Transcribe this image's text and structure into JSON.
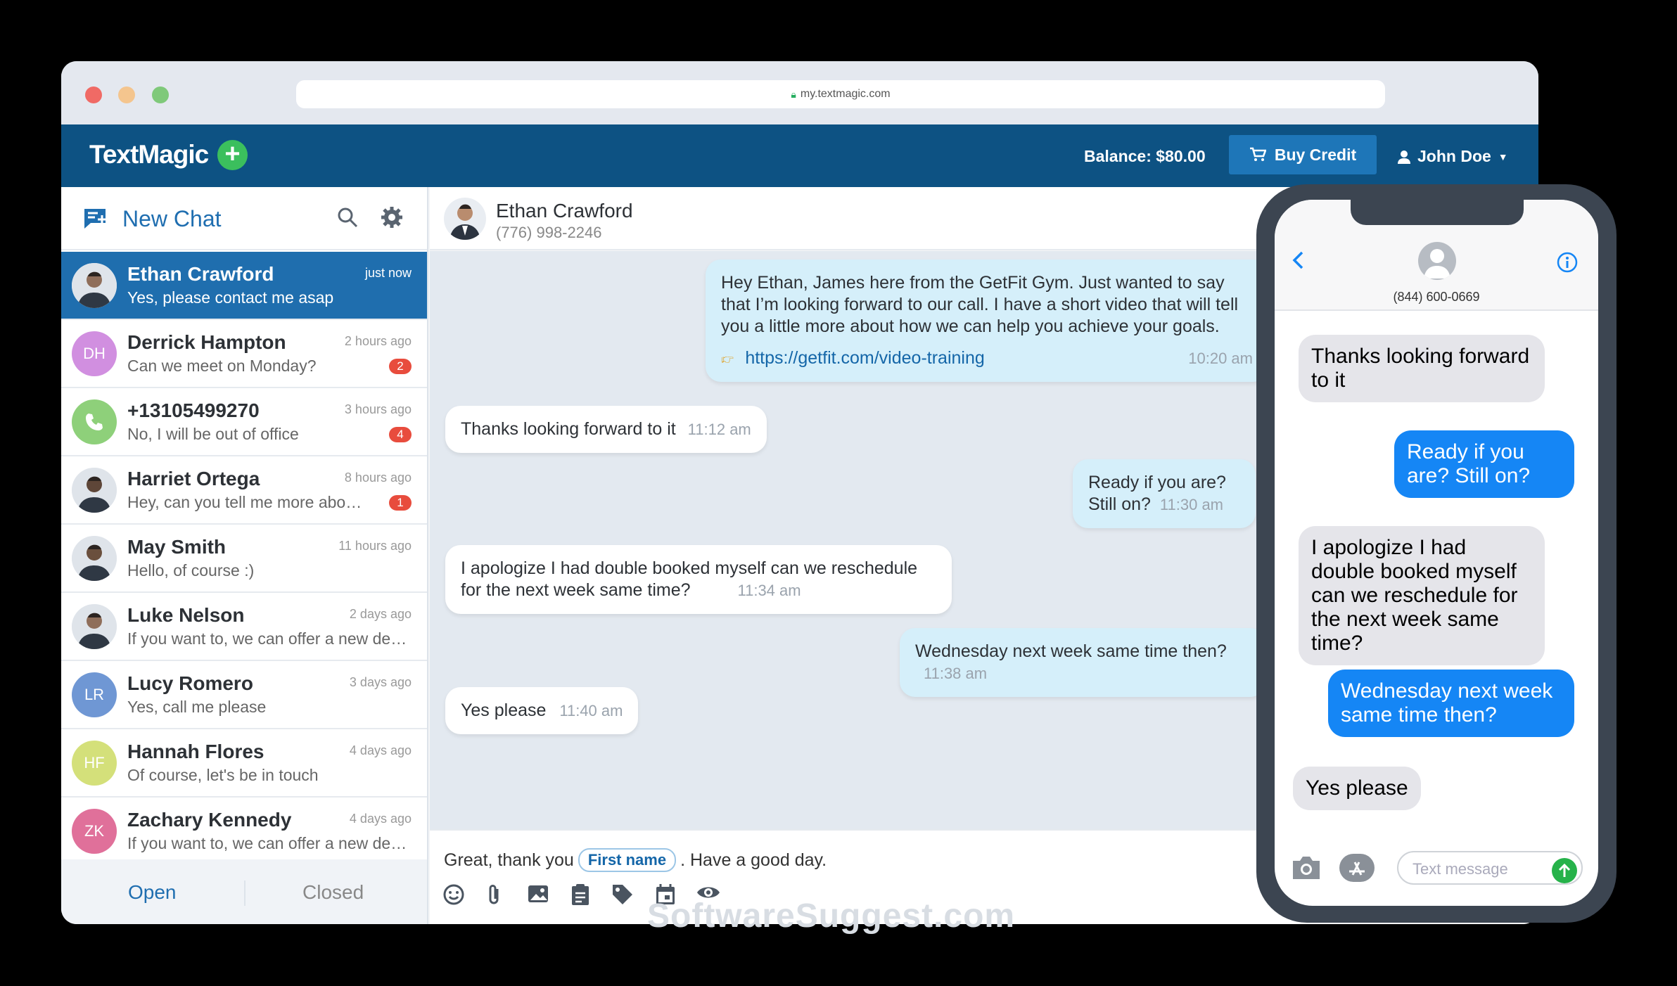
{
  "browser": {
    "url": "my.textmagic.com"
  },
  "header": {
    "logo": "TextMagic",
    "balance": "Balance: $80.00",
    "buy_credit": "Buy Credit",
    "user": "John Doe"
  },
  "sidebar": {
    "new_chat": "New Chat",
    "conversations": [
      {
        "name": "Ethan Crawford",
        "preview": "Yes, please contact me asap",
        "time": "just now",
        "badge": "",
        "initials": "",
        "color": ""
      },
      {
        "name": "Derrick Hampton",
        "preview": "Can we meet on Monday?",
        "time": "2 hours ago",
        "badge": "2",
        "initials": "DH",
        "color": "#d18fe0"
      },
      {
        "name": "+13105499270",
        "preview": "No, I will be out of office",
        "time": "3 hours ago",
        "badge": "4",
        "initials": "",
        "color": "#8ed07a"
      },
      {
        "name": "Harriet Ortega",
        "preview": "Hey, can you tell me more abo…",
        "time": "8 hours ago",
        "badge": "1",
        "initials": "",
        "color": ""
      },
      {
        "name": "May Smith",
        "preview": "Hello, of course :)",
        "time": "11 hours ago",
        "badge": "",
        "initials": "",
        "color": ""
      },
      {
        "name": "Luke Nelson",
        "preview": "If you want to, we can offer a new de…",
        "time": "2 days ago",
        "badge": "",
        "initials": "",
        "color": ""
      },
      {
        "name": "Lucy Romero",
        "preview": "Yes, call me please",
        "time": "3 days ago",
        "badge": "",
        "initials": "LR",
        "color": "#6f97d4"
      },
      {
        "name": "Hannah Flores",
        "preview": "Of course, let's be in touch",
        "time": "4 days ago",
        "badge": "",
        "initials": "HF",
        "color": "#d4e07a"
      },
      {
        "name": "Zachary Kennedy",
        "preview": "If you want to, we can offer a new de…",
        "time": "4 days ago",
        "badge": "",
        "initials": "ZK",
        "color": "#e0709a"
      }
    ],
    "tabs": {
      "open": "Open",
      "closed": "Closed"
    }
  },
  "chat": {
    "name": "Ethan Crawford",
    "phone": "(776) 998-2246",
    "messages": [
      {
        "dir": "out",
        "text": "Hey Ethan, James here from the GetFit Gym. Just wanted to say that I’m looking forward to our call. I have a short video that will tell you a little more about how we can help you achieve your goals.",
        "link": "https://getfit.com/video-training",
        "time": "10:20 am"
      },
      {
        "dir": "in",
        "text": "Thanks looking forward to it",
        "time": "11:12 am"
      },
      {
        "dir": "out",
        "text": "Ready if you are? Still on?",
        "time": "11:30 am"
      },
      {
        "dir": "in",
        "text": "I apologize I had double booked myself can we reschedule for the next week same time?",
        "time": "11:34 am"
      },
      {
        "dir": "out",
        "text": "Wednesday next week same time then?",
        "time": "11:38 am"
      },
      {
        "dir": "in",
        "text": "Yes please",
        "time": "11:40 am"
      }
    ],
    "composer": {
      "before": "Great, thank you",
      "chip": "First name",
      "after": ". Have a good day."
    }
  },
  "phone": {
    "number": "(844) 600-0669",
    "messages": [
      {
        "dir": "in",
        "text": "Thanks looking forward to it"
      },
      {
        "dir": "out",
        "text": "Ready if you are? Still on?"
      },
      {
        "dir": "in",
        "text": "I apologize I had double booked myself can we reschedule for the next week same time?"
      },
      {
        "dir": "out",
        "text": "Wednesday next week same time then?"
      },
      {
        "dir": "in",
        "text": "Yes please"
      }
    ],
    "input_placeholder": "Text message"
  },
  "watermark": "SoftwareSuggest.com"
}
